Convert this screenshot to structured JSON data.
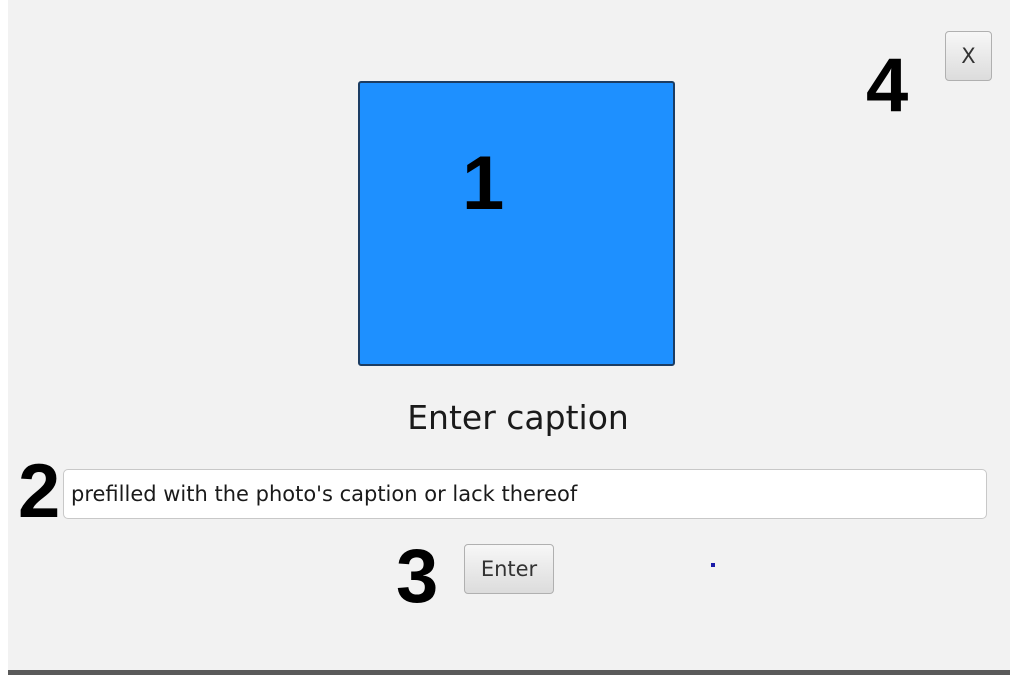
{
  "dialog": {
    "photo_color": "#1e90ff",
    "caption_heading": "Enter caption",
    "caption_input": {
      "value": "prefilled with the photo's caption or lack thereof"
    },
    "enter_button_label": "Enter",
    "close_button_label": "X"
  },
  "markers": {
    "one": "1",
    "two": "2",
    "three": "3",
    "four": "4"
  }
}
